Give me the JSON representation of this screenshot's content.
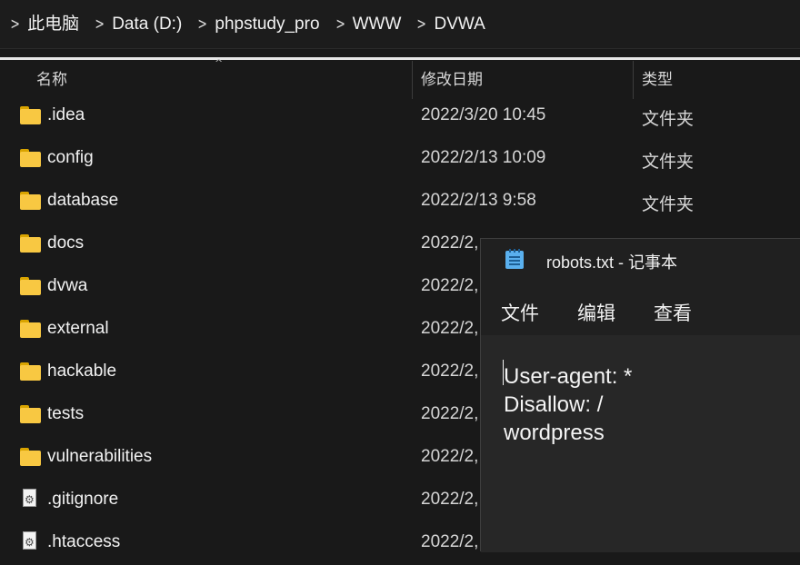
{
  "address_bar": {
    "crumbs": [
      "此电脑",
      "Data (D:)",
      "phpstudy_pro",
      "WWW",
      "DVWA"
    ]
  },
  "columns": {
    "name": "名称",
    "modified": "修改日期",
    "type": "类型"
  },
  "files": [
    {
      "name": ".idea",
      "date": "2022/3/20 10:45",
      "type": "文件夹",
      "icon": "folder-icon"
    },
    {
      "name": "config",
      "date": "2022/2/13 10:09",
      "type": "文件夹",
      "icon": "folder-icon"
    },
    {
      "name": "database",
      "date": "2022/2/13 9:58",
      "type": "文件夹",
      "icon": "folder-icon"
    },
    {
      "name": "docs",
      "date": "2022/2,",
      "type": "",
      "icon": "folder-icon"
    },
    {
      "name": "dvwa",
      "date": "2022/2,",
      "type": "",
      "icon": "folder-icon"
    },
    {
      "name": "external",
      "date": "2022/2,",
      "type": "",
      "icon": "folder-icon"
    },
    {
      "name": "hackable",
      "date": "2022/2,",
      "type": "",
      "icon": "folder-icon"
    },
    {
      "name": "tests",
      "date": "2022/2,",
      "type": "",
      "icon": "folder-icon"
    },
    {
      "name": "vulnerabilities",
      "date": "2022/2,",
      "type": "",
      "icon": "folder-icon"
    },
    {
      "name": ".gitignore",
      "date": "2022/2,",
      "type": "",
      "icon": "config-file-icon"
    },
    {
      "name": ".htaccess",
      "date": "2022/2,",
      "type": "",
      "icon": "config-file-icon"
    }
  ],
  "notepad": {
    "title": "robots.txt - 记事本",
    "menu": [
      "文件",
      "编辑",
      "查看"
    ],
    "content": "User-agent: *\nDisallow: /\nwordpress"
  },
  "colors": {
    "background": "#191919",
    "folder": "#f8c842",
    "notepad_editor": "#272727"
  }
}
